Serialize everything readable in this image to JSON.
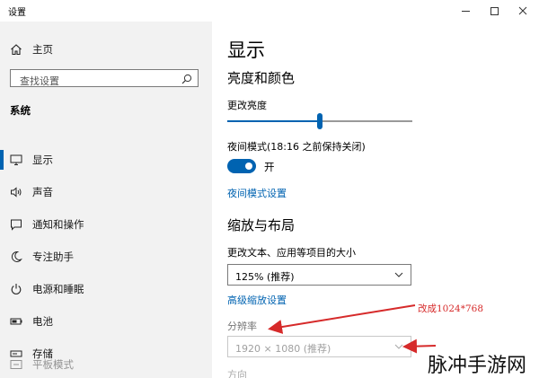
{
  "window": {
    "title": "设置"
  },
  "nav": {
    "home_label": "主页",
    "search_placeholder": "查找设置",
    "section_heading": "系统",
    "items": [
      {
        "label": "显示",
        "icon": "monitor-icon",
        "active": true
      },
      {
        "label": "声音",
        "icon": "speaker-icon",
        "active": false
      },
      {
        "label": "通知和操作",
        "icon": "notification-icon",
        "active": false
      },
      {
        "label": "专注助手",
        "icon": "moon-icon",
        "active": false
      },
      {
        "label": "电源和睡眠",
        "icon": "power-icon",
        "active": false
      },
      {
        "label": "电池",
        "icon": "battery-icon",
        "active": false
      },
      {
        "label": "存储",
        "icon": "storage-icon",
        "active": false
      },
      {
        "label": "平板模式",
        "icon": "tablet-mode-icon",
        "active": false
      }
    ]
  },
  "main": {
    "title": "显示",
    "brightness_section": "亮度和颜色",
    "brightness_label": "更改亮度",
    "brightness_level": 0.5,
    "night_light_label": "夜间模式(18:16 之前保持关闭)",
    "night_light_toggle": "开",
    "night_light_on": true,
    "night_light_link": "夜间模式设置",
    "scale_section": "缩放与布局",
    "scale_label": "更改文本、应用等项目的大小",
    "scale_value": "125% (推荐)",
    "advanced_scale_link": "高级缩放设置",
    "resolution_label": "分辨率",
    "resolution_value": "1920 × 1080 (推荐)",
    "orientation_label": "方向"
  },
  "annotation": {
    "text": "改成1024*768",
    "color": "#d62a2a"
  },
  "watermark": {
    "text": "脉冲手游网"
  },
  "colors": {
    "accent": "#0063b1",
    "nav_background": "#f2f2f2"
  }
}
